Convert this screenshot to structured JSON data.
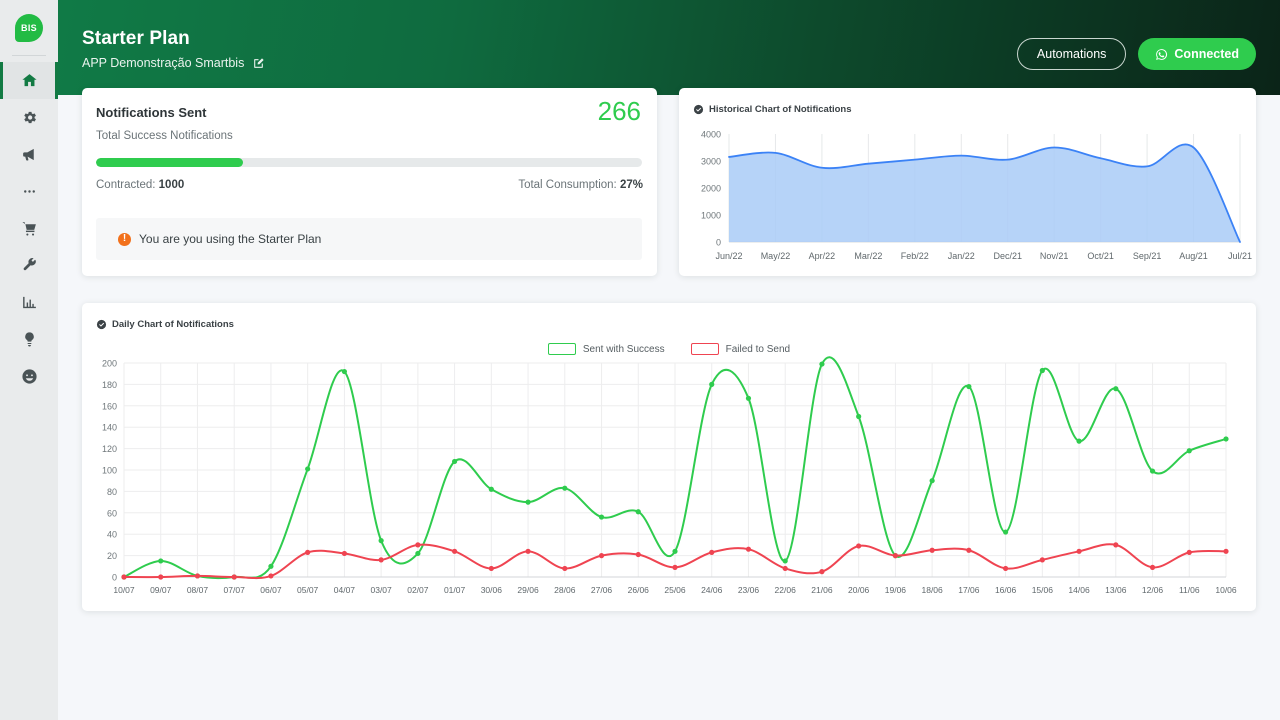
{
  "app": {
    "logo_text": "BIS",
    "background_color": "#f5f7fa",
    "sidebar_color": "#e9ebec",
    "accent_green": "#2fcc4e",
    "header_green": "#107a46"
  },
  "sidebar": {
    "items": [
      {
        "icon": "home-icon",
        "label": "Home",
        "active": true
      },
      {
        "icon": "gear-icon",
        "label": "Settings",
        "active": false
      },
      {
        "icon": "megaphone-icon",
        "label": "Campaigns",
        "active": false
      },
      {
        "icon": "ellipsis-icon",
        "label": "More",
        "active": false
      },
      {
        "icon": "cart-icon",
        "label": "Store",
        "active": false
      },
      {
        "icon": "wrench-icon",
        "label": "Tools",
        "active": false
      },
      {
        "icon": "bar-chart-icon",
        "label": "Reports",
        "active": false
      },
      {
        "icon": "lightbulb-icon",
        "label": "Ideas",
        "active": false
      },
      {
        "icon": "smiley-icon",
        "label": "Support",
        "active": false
      }
    ]
  },
  "header": {
    "title": "Starter Plan",
    "subtitle": "APP Demonstração Smartbis",
    "edit_icon": "edit-square-icon",
    "automations_label": "Automations",
    "connected_label": "Connected",
    "connected_icon": "whatsapp-icon"
  },
  "notifications_card": {
    "title": "Notifications Sent",
    "count": "266",
    "subtitle": "Total Success Notifications",
    "contracted_label": "Contracted:",
    "contracted_value": "1000",
    "consumption_label": "Total Consumption:",
    "consumption_value": "27%",
    "progress_percent": 27,
    "alert_icon": "warning-icon",
    "alert_text": "You are you using the Starter Plan"
  },
  "historical_card": {
    "icon": "check-circle-icon",
    "title": "Historical Chart of Notifications"
  },
  "daily_card": {
    "icon": "check-circle-icon",
    "title": "Daily Chart of Notifications",
    "legend": [
      {
        "name": "Sent with Success",
        "color": "#2fcc4e"
      },
      {
        "name": "Failed to Send",
        "color": "#ef4451"
      }
    ]
  },
  "chart_data": [
    {
      "id": "historical",
      "type": "area",
      "title": "Historical Chart of Notifications",
      "xlabel": "",
      "ylabel": "",
      "ylim": [
        0,
        4000
      ],
      "yticks": [
        0,
        1000,
        2000,
        3000,
        4000
      ],
      "grid": true,
      "legend_position": "none",
      "line_color": "#3b82f6",
      "fill_color": "#a9cbf7",
      "categories": [
        "Jun/22",
        "May/22",
        "Apr/22",
        "Mar/22",
        "Feb/22",
        "Jan/22",
        "Dec/21",
        "Nov/21",
        "Oct/21",
        "Sep/21",
        "Aug/21",
        "Jul/21"
      ],
      "values": [
        3150,
        3300,
        2750,
        2900,
        3050,
        3200,
        3050,
        3500,
        3100,
        2800,
        3500,
        0
      ]
    },
    {
      "id": "daily",
      "type": "line",
      "title": "Daily Chart of Notifications",
      "xlabel": "",
      "ylabel": "",
      "ylim": [
        0,
        200
      ],
      "yticks": [
        0,
        20,
        40,
        60,
        80,
        100,
        120,
        140,
        160,
        180,
        200
      ],
      "grid": true,
      "legend_position": "top-center",
      "categories": [
        "10/07",
        "09/07",
        "08/07",
        "07/07",
        "06/07",
        "05/07",
        "04/07",
        "03/07",
        "02/07",
        "01/07",
        "30/06",
        "29/06",
        "28/06",
        "27/06",
        "26/06",
        "25/06",
        "24/06",
        "23/06",
        "22/06",
        "21/06",
        "20/06",
        "19/06",
        "18/06",
        "17/06",
        "16/06",
        "15/06",
        "14/06",
        "13/06",
        "12/06",
        "11/06",
        "10/06"
      ],
      "series": [
        {
          "name": "Sent with Success",
          "color": "#2fcc4e",
          "values": [
            0,
            15,
            1,
            0,
            10,
            101,
            192,
            34,
            22,
            108,
            82,
            70,
            83,
            56,
            61,
            24,
            180,
            167,
            15,
            199,
            150,
            20,
            90,
            178,
            42,
            193,
            127,
            176,
            99,
            118,
            129
          ]
        },
        {
          "name": "Failed to Send",
          "color": "#ef4451",
          "values": [
            0,
            0,
            1,
            0,
            1,
            23,
            22,
            16,
            30,
            24,
            8,
            24,
            8,
            20,
            21,
            9,
            23,
            26,
            8,
            5,
            29,
            20,
            25,
            25,
            8,
            16,
            24,
            30,
            9,
            23,
            24
          ]
        }
      ]
    }
  ]
}
